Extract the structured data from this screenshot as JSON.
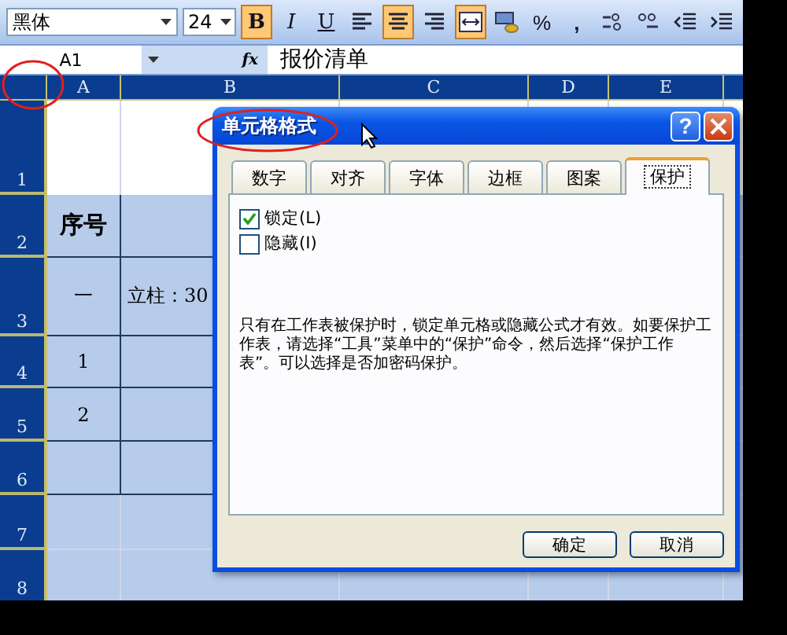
{
  "toolbar": {
    "font": "黑体",
    "size": "24",
    "buttons": [
      {
        "kind": "bold",
        "label": "B",
        "on": true
      },
      {
        "kind": "italic",
        "label": "I",
        "on": false
      },
      {
        "kind": "underline",
        "label": "U",
        "on": false
      },
      {
        "kind": "align-left",
        "on": false
      },
      {
        "kind": "align-center",
        "on": true
      },
      {
        "kind": "align-right",
        "on": false
      },
      {
        "kind": "merge",
        "on": true
      },
      {
        "kind": "currency",
        "on": false
      },
      {
        "kind": "percent",
        "label": "%",
        "on": false
      },
      {
        "kind": "comma",
        "label": ",",
        "on": false
      },
      {
        "kind": "decimal-more",
        "on": false
      },
      {
        "kind": "decimal-less",
        "on": false
      },
      {
        "kind": "outdent",
        "on": false
      },
      {
        "kind": "indent",
        "on": false
      }
    ]
  },
  "formula_bar": {
    "name_box": "A1",
    "fx": "fx",
    "value": "报价清单"
  },
  "sheet": {
    "columns": [
      "A",
      "B",
      "C",
      "D",
      "E"
    ],
    "rows": [
      {
        "header": "1",
        "selected": false,
        "cells": []
      },
      {
        "header": "2",
        "selected": true,
        "cells": [
          "序号"
        ]
      },
      {
        "header": "3",
        "selected": true,
        "cells": [
          "一",
          "立柱：30"
        ]
      },
      {
        "header": "4",
        "selected": true,
        "cells": [
          "1"
        ]
      },
      {
        "header": "5",
        "selected": true,
        "cells": [
          "2"
        ]
      },
      {
        "header": "6",
        "selected": true,
        "cells": []
      },
      {
        "header": "7",
        "selected": true,
        "cells": []
      },
      {
        "header": "8",
        "selected": true,
        "cells": []
      }
    ]
  },
  "dialog": {
    "title": "单元格格式",
    "help": "?",
    "tabs": [
      {
        "label": "数字",
        "selected": false
      },
      {
        "label": "对齐",
        "selected": false
      },
      {
        "label": "字体",
        "selected": false
      },
      {
        "label": "边框",
        "selected": false
      },
      {
        "label": "图案",
        "selected": false
      },
      {
        "label": "保护",
        "selected": true
      }
    ],
    "options": [
      {
        "label": "锁定(L)",
        "checked": true
      },
      {
        "label": "隐藏(I)",
        "checked": false
      }
    ],
    "note": "只有在工作表被保护时，锁定单元格或隐藏公式才有效。如要保护工作表，请选择“工具”菜单中的“保护”命令，然后选择“保护工作表”。可以选择是否加密码保护。",
    "buttons": [
      "确定",
      "取消"
    ]
  }
}
